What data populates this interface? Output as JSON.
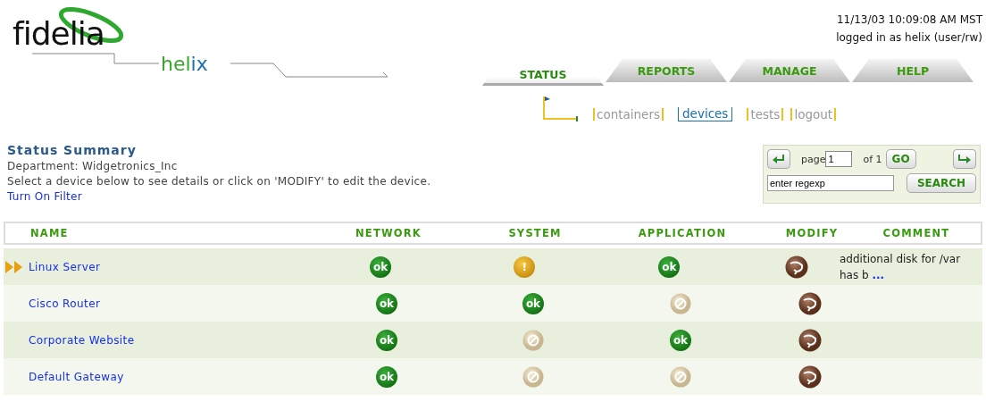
{
  "logo": {
    "brand": "fidelia",
    "product_parts": [
      "hel",
      "ix"
    ]
  },
  "session": {
    "datetime": "11/13/03 10:09:08 AM MST",
    "user": "logged in as helix (user/rw)"
  },
  "tabs": [
    {
      "label": "STATUS",
      "selected": true
    },
    {
      "label": "REPORTS",
      "selected": false
    },
    {
      "label": "MANAGE",
      "selected": false
    },
    {
      "label": "HELP",
      "selected": false
    }
  ],
  "subnav": [
    {
      "label": "containers",
      "selected": false
    },
    {
      "label": "devices",
      "selected": true
    },
    {
      "label": "tests",
      "selected": false
    },
    {
      "label": "logout",
      "selected": false
    }
  ],
  "summary": {
    "title": "Status Summary",
    "department": "Department:  Widgetronics_Inc",
    "instructions": "Select a device below to see details or click on 'MODIFY' to edit the device.",
    "filter_link": "Turn On Filter"
  },
  "pager": {
    "page_label": "page",
    "page_value": "1",
    "of_label": "of 1",
    "go": "GO",
    "search_value": "enter regexp",
    "search": "SEARCH"
  },
  "table": {
    "columns": [
      "NAME",
      "NETWORK",
      "SYSTEM",
      "APPLICATION",
      "MODIFY",
      "COMMENT"
    ],
    "rows": [
      {
        "name": "Linux Server",
        "selected": true,
        "statuses": [
          {
            "kind": "ok",
            "symbol": "ok"
          },
          {
            "kind": "warning",
            "symbol": "!"
          },
          {
            "kind": "ok",
            "symbol": "ok"
          }
        ],
        "comment": "additional disk for /var has b",
        "more": "..."
      },
      {
        "name": "Cisco Router",
        "selected": false,
        "statuses": [
          {
            "kind": "ok",
            "symbol": "ok"
          },
          {
            "kind": "ok",
            "symbol": "ok"
          },
          {
            "kind": "none"
          }
        ]
      },
      {
        "name": "Corporate Website",
        "selected": false,
        "statuses": [
          {
            "kind": "ok",
            "symbol": "ok"
          },
          {
            "kind": "none"
          },
          {
            "kind": "ok",
            "symbol": "ok"
          }
        ]
      },
      {
        "name": "Default Gateway",
        "selected": false,
        "statuses": [
          {
            "kind": "ok",
            "symbol": "ok"
          },
          {
            "kind": "none"
          },
          {
            "kind": "none"
          }
        ]
      }
    ]
  }
}
